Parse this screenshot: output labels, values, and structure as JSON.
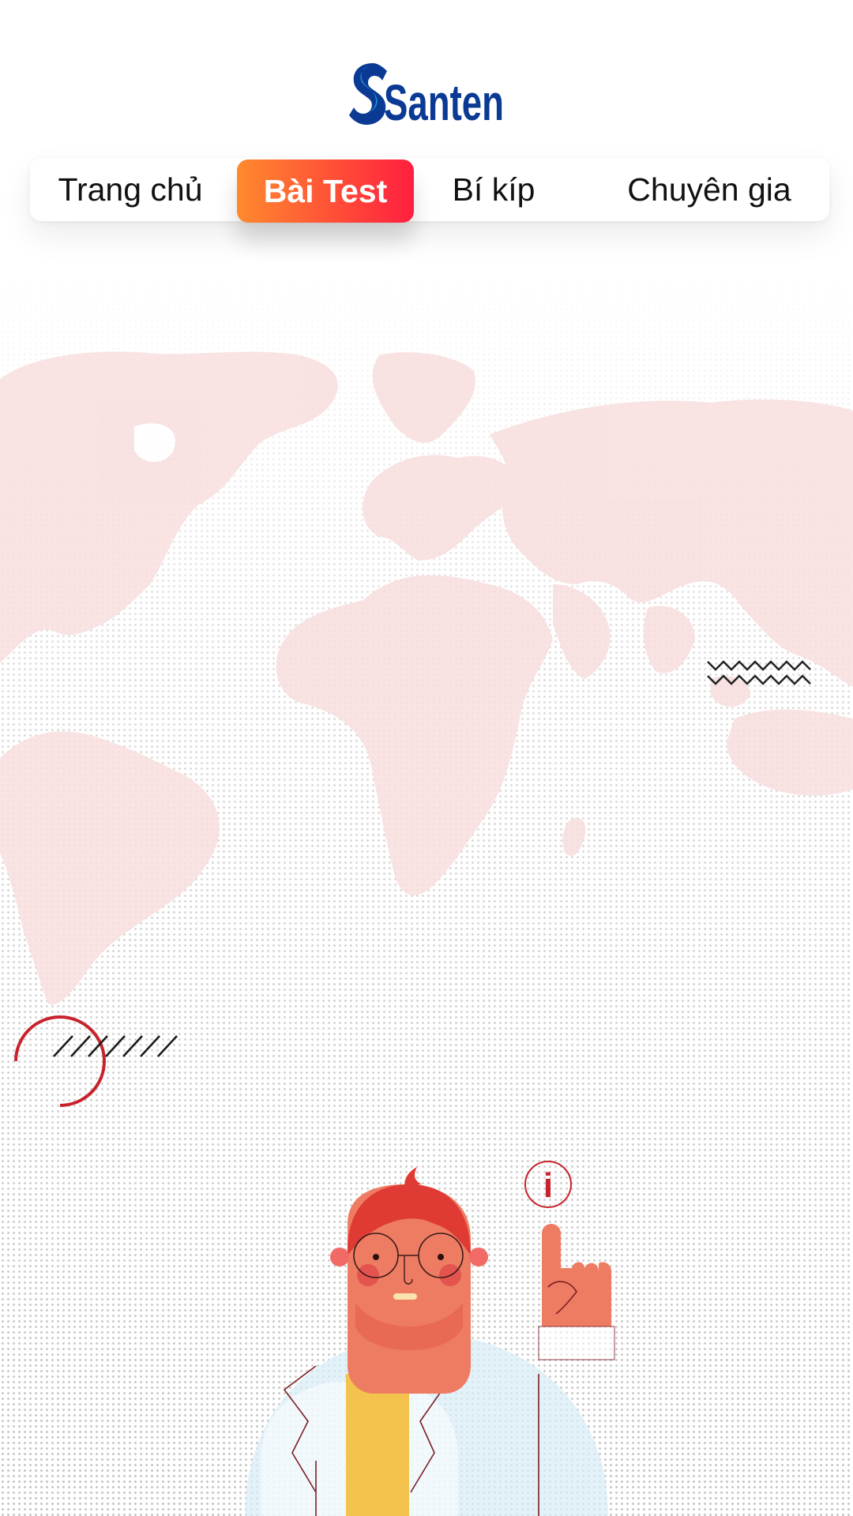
{
  "logo": {
    "text": "Santen",
    "color": "#0b3a94",
    "accent": "#1a9be0"
  },
  "nav": {
    "items": [
      {
        "label": "Trang chủ",
        "active": false
      },
      {
        "label": "Bài Test",
        "active": true
      },
      {
        "label": "Bí kíp",
        "active": false
      },
      {
        "label": "Chuyên gia",
        "active": false
      }
    ]
  },
  "colors": {
    "active_gradient_start": "#ff8a2e",
    "active_gradient_end": "#ff1f3f",
    "map_tint": "#f8dede",
    "decor_red": "#c8232c"
  },
  "decor": {
    "map": "world-map-illustration",
    "zigzag": "zigzag-lines",
    "circle": "half-circle-outline",
    "slashes": "diagonal-slash-lines",
    "character": "doctor-pointing-up-illustration",
    "info": "info-icon",
    "info_glyph": "i"
  }
}
